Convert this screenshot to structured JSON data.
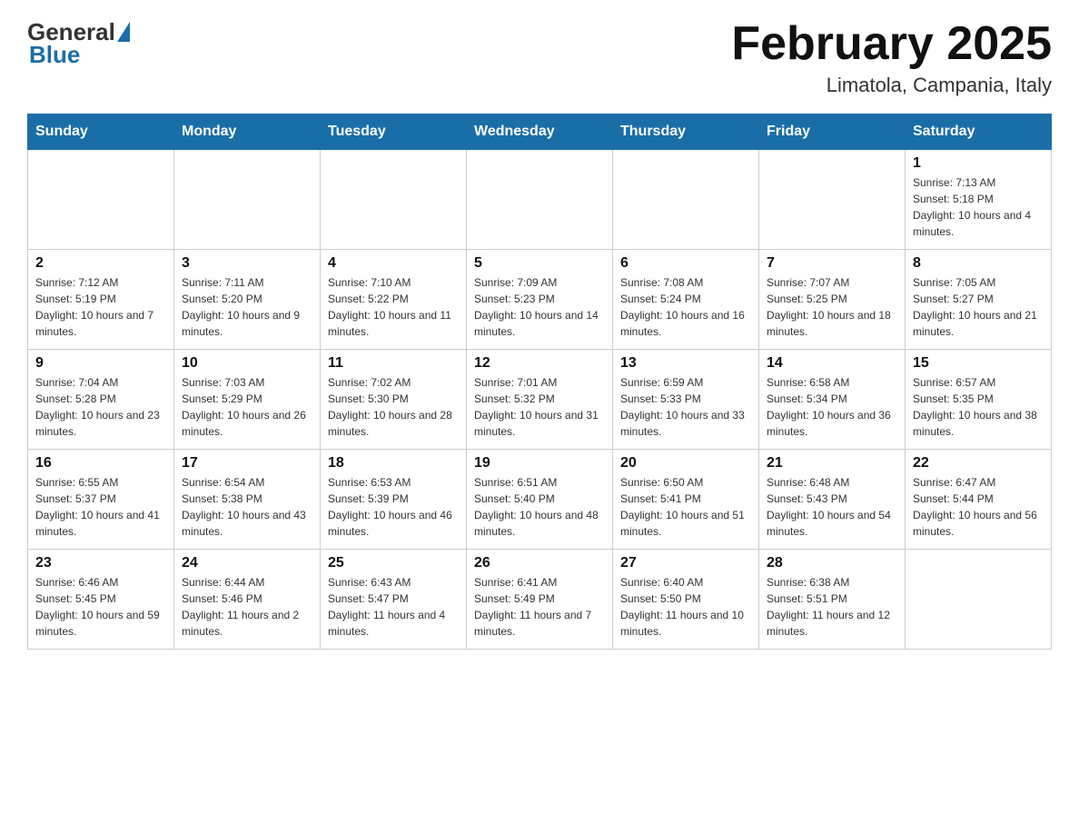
{
  "header": {
    "logo": {
      "general": "General",
      "blue": "Blue"
    },
    "title": "February 2025",
    "location": "Limatola, Campania, Italy"
  },
  "weekdays": [
    "Sunday",
    "Monday",
    "Tuesday",
    "Wednesday",
    "Thursday",
    "Friday",
    "Saturday"
  ],
  "weeks": [
    {
      "days": [
        {
          "number": "",
          "info": "",
          "empty": true
        },
        {
          "number": "",
          "info": "",
          "empty": true
        },
        {
          "number": "",
          "info": "",
          "empty": true
        },
        {
          "number": "",
          "info": "",
          "empty": true
        },
        {
          "number": "",
          "info": "",
          "empty": true
        },
        {
          "number": "",
          "info": "",
          "empty": true
        },
        {
          "number": "1",
          "info": "Sunrise: 7:13 AM\nSunset: 5:18 PM\nDaylight: 10 hours and 4 minutes."
        }
      ]
    },
    {
      "days": [
        {
          "number": "2",
          "info": "Sunrise: 7:12 AM\nSunset: 5:19 PM\nDaylight: 10 hours and 7 minutes."
        },
        {
          "number": "3",
          "info": "Sunrise: 7:11 AM\nSunset: 5:20 PM\nDaylight: 10 hours and 9 minutes."
        },
        {
          "number": "4",
          "info": "Sunrise: 7:10 AM\nSunset: 5:22 PM\nDaylight: 10 hours and 11 minutes."
        },
        {
          "number": "5",
          "info": "Sunrise: 7:09 AM\nSunset: 5:23 PM\nDaylight: 10 hours and 14 minutes."
        },
        {
          "number": "6",
          "info": "Sunrise: 7:08 AM\nSunset: 5:24 PM\nDaylight: 10 hours and 16 minutes."
        },
        {
          "number": "7",
          "info": "Sunrise: 7:07 AM\nSunset: 5:25 PM\nDaylight: 10 hours and 18 minutes."
        },
        {
          "number": "8",
          "info": "Sunrise: 7:05 AM\nSunset: 5:27 PM\nDaylight: 10 hours and 21 minutes."
        }
      ]
    },
    {
      "days": [
        {
          "number": "9",
          "info": "Sunrise: 7:04 AM\nSunset: 5:28 PM\nDaylight: 10 hours and 23 minutes."
        },
        {
          "number": "10",
          "info": "Sunrise: 7:03 AM\nSunset: 5:29 PM\nDaylight: 10 hours and 26 minutes."
        },
        {
          "number": "11",
          "info": "Sunrise: 7:02 AM\nSunset: 5:30 PM\nDaylight: 10 hours and 28 minutes."
        },
        {
          "number": "12",
          "info": "Sunrise: 7:01 AM\nSunset: 5:32 PM\nDaylight: 10 hours and 31 minutes."
        },
        {
          "number": "13",
          "info": "Sunrise: 6:59 AM\nSunset: 5:33 PM\nDaylight: 10 hours and 33 minutes."
        },
        {
          "number": "14",
          "info": "Sunrise: 6:58 AM\nSunset: 5:34 PM\nDaylight: 10 hours and 36 minutes."
        },
        {
          "number": "15",
          "info": "Sunrise: 6:57 AM\nSunset: 5:35 PM\nDaylight: 10 hours and 38 minutes."
        }
      ]
    },
    {
      "days": [
        {
          "number": "16",
          "info": "Sunrise: 6:55 AM\nSunset: 5:37 PM\nDaylight: 10 hours and 41 minutes."
        },
        {
          "number": "17",
          "info": "Sunrise: 6:54 AM\nSunset: 5:38 PM\nDaylight: 10 hours and 43 minutes."
        },
        {
          "number": "18",
          "info": "Sunrise: 6:53 AM\nSunset: 5:39 PM\nDaylight: 10 hours and 46 minutes."
        },
        {
          "number": "19",
          "info": "Sunrise: 6:51 AM\nSunset: 5:40 PM\nDaylight: 10 hours and 48 minutes."
        },
        {
          "number": "20",
          "info": "Sunrise: 6:50 AM\nSunset: 5:41 PM\nDaylight: 10 hours and 51 minutes."
        },
        {
          "number": "21",
          "info": "Sunrise: 6:48 AM\nSunset: 5:43 PM\nDaylight: 10 hours and 54 minutes."
        },
        {
          "number": "22",
          "info": "Sunrise: 6:47 AM\nSunset: 5:44 PM\nDaylight: 10 hours and 56 minutes."
        }
      ]
    },
    {
      "days": [
        {
          "number": "23",
          "info": "Sunrise: 6:46 AM\nSunset: 5:45 PM\nDaylight: 10 hours and 59 minutes."
        },
        {
          "number": "24",
          "info": "Sunrise: 6:44 AM\nSunset: 5:46 PM\nDaylight: 11 hours and 2 minutes."
        },
        {
          "number": "25",
          "info": "Sunrise: 6:43 AM\nSunset: 5:47 PM\nDaylight: 11 hours and 4 minutes."
        },
        {
          "number": "26",
          "info": "Sunrise: 6:41 AM\nSunset: 5:49 PM\nDaylight: 11 hours and 7 minutes."
        },
        {
          "number": "27",
          "info": "Sunrise: 6:40 AM\nSunset: 5:50 PM\nDaylight: 11 hours and 10 minutes."
        },
        {
          "number": "28",
          "info": "Sunrise: 6:38 AM\nSunset: 5:51 PM\nDaylight: 11 hours and 12 minutes."
        },
        {
          "number": "",
          "info": "",
          "empty": true
        }
      ]
    }
  ]
}
